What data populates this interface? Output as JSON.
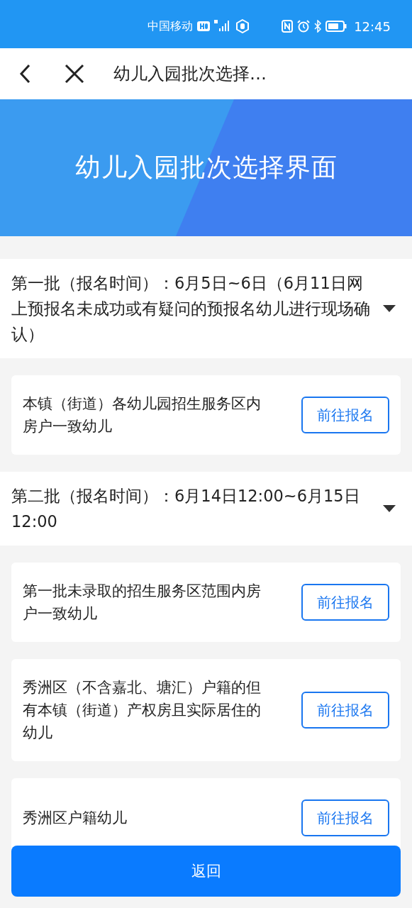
{
  "status_bar": {
    "carrier": "中国移动",
    "time": "12:45"
  },
  "nav": {
    "title": "幼儿入园批次选择…"
  },
  "banner": {
    "title": "幼儿入园批次选择界面"
  },
  "batches": [
    {
      "title": "第一批（报名时间）：6月5日~6日（6月11日网上预报名未成功或有疑问的预报名幼儿进行现场确认）",
      "expanded": true,
      "items": [
        {
          "text": "本镇（街道）各幼儿园招生服务区内房户一致幼儿",
          "action": "前往报名"
        }
      ]
    },
    {
      "title": "第二批（报名时间）：6月14日12:00~6月15日12:00",
      "expanded": true,
      "items": [
        {
          "text": "第一批未录取的招生服务区范围内房户一致幼儿",
          "action": "前往报名"
        },
        {
          "text": "秀洲区（不含嘉北、塘汇）户籍的但有本镇（街道）产权房且实际居住的幼儿",
          "action": "前往报名"
        },
        {
          "text": "秀洲区户籍幼儿",
          "action": "前往报名"
        }
      ]
    }
  ],
  "footer_button": "返回"
}
